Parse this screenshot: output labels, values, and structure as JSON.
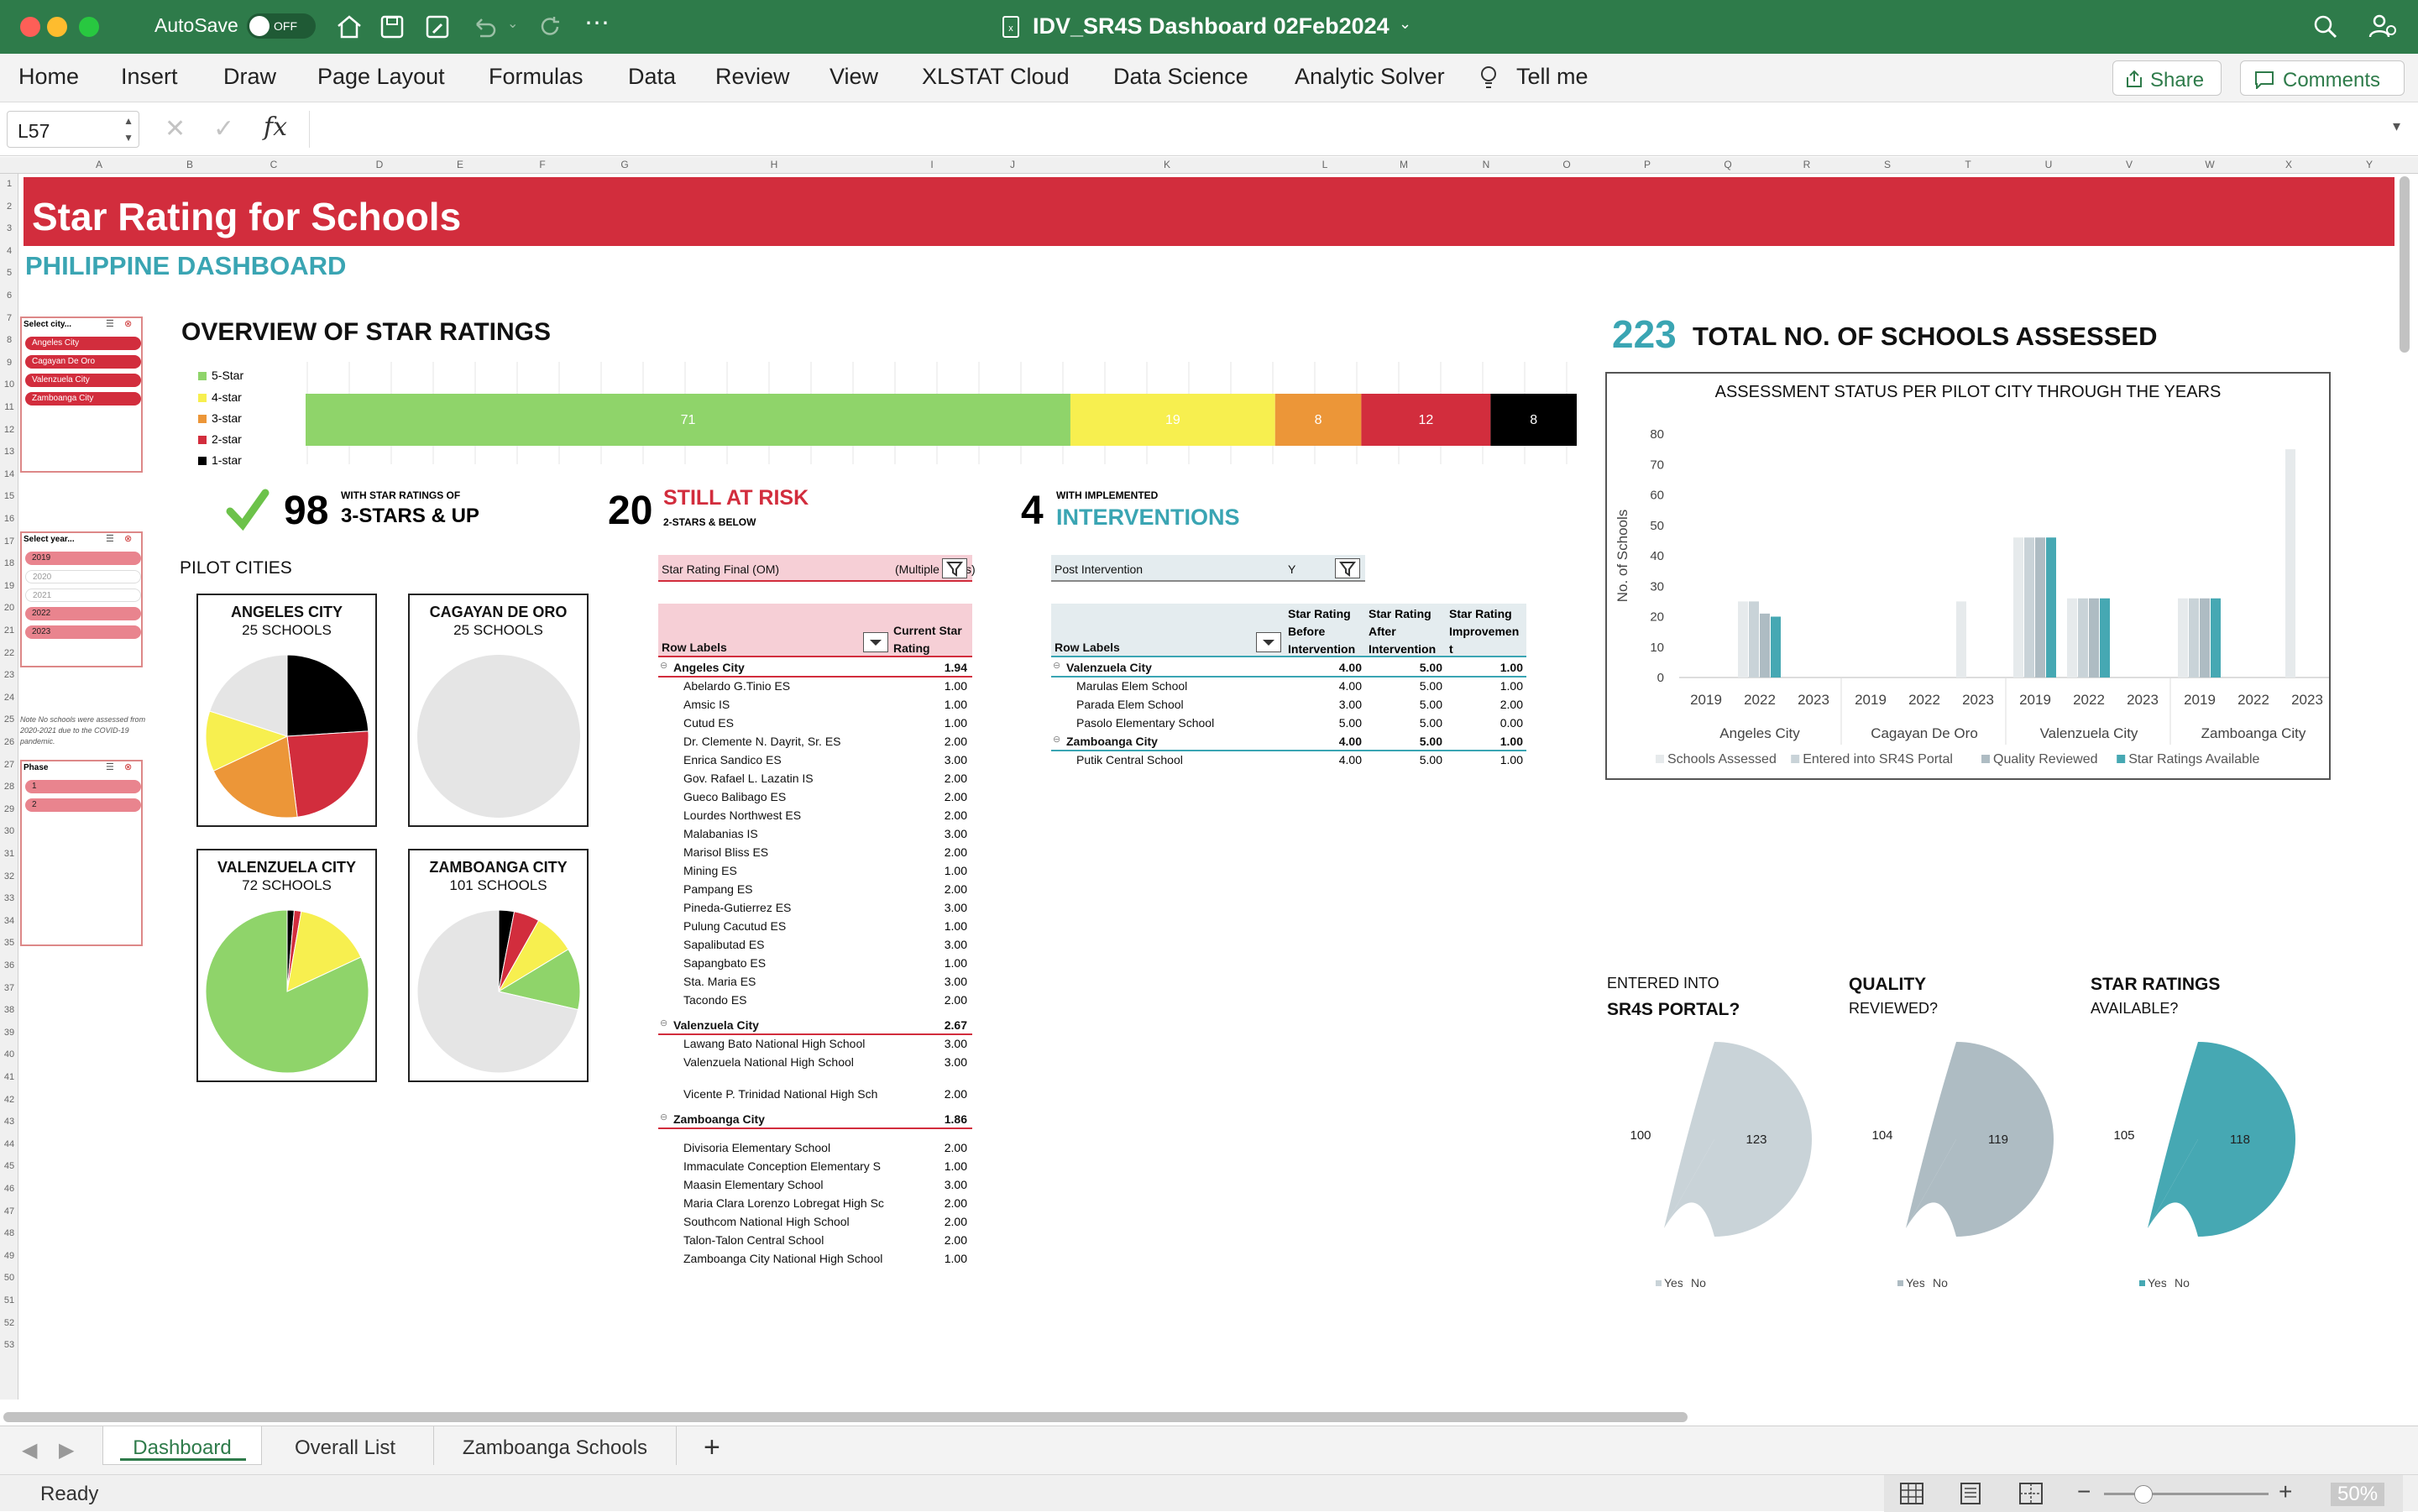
{
  "window": {
    "autosave": "AutoSave",
    "autosave_state": "OFF",
    "title": "IDV_SR4S Dashboard 02Feb2024"
  },
  "menu": {
    "items": [
      "Home",
      "Insert",
      "Draw",
      "Page Layout",
      "Formulas",
      "Data",
      "Review",
      "View",
      "XLSTAT Cloud",
      "Data Science",
      "Analytic Solver"
    ],
    "tell_me": "Tell me",
    "share": "Share",
    "comments": "Comments"
  },
  "formula": {
    "cell_ref": "L57",
    "fx": "fx",
    "value": ""
  },
  "columns": [
    "A",
    "B",
    "C",
    "D",
    "E",
    "F",
    "G",
    "H",
    "I",
    "J",
    "K",
    "L",
    "M",
    "N",
    "O",
    "P",
    "Q",
    "R",
    "S",
    "T",
    "U",
    "V",
    "W",
    "X",
    "Y"
  ],
  "rows": [
    "1",
    "2",
    "3",
    "4",
    "5",
    "6",
    "7",
    "8",
    "9",
    "10",
    "11",
    "12",
    "13",
    "14",
    "15",
    "16",
    "17",
    "18",
    "19",
    "20",
    "21",
    "22",
    "23",
    "24",
    "25",
    "26",
    "27",
    "28",
    "29",
    "30",
    "31",
    "32",
    "33",
    "34",
    "35",
    "36",
    "37",
    "38",
    "39",
    "40",
    "41",
    "42",
    "43",
    "44",
    "45",
    "46",
    "47",
    "48",
    "49",
    "50",
    "51",
    "52",
    "53"
  ],
  "dashboard": {
    "title": "Star Rating for Schools",
    "subtitle": "PHILIPPINE DASHBOARD",
    "overview_title": "OVERVIEW OF STAR RATINGS",
    "legend": [
      "5-Star",
      "4-star",
      "3-star",
      "2-star",
      "1-star"
    ],
    "star_colors": [
      "#8fd46a",
      "#f7ef4f",
      "#ec9638",
      "#d22d3d",
      "#000000"
    ],
    "bar_values": [
      71,
      19,
      8,
      12,
      8
    ],
    "kpi1_value": "98",
    "kpi1_label_small": "WITH STAR RATINGS OF",
    "kpi1_label_big": "3-STARS & UP",
    "kpi2_value": "20",
    "kpi2_label_big": "STILL AT RISK",
    "kpi2_label_small": "2-STARS & BELOW",
    "kpi3_value": "4",
    "kpi3_label_small": "WITH IMPLEMENTED",
    "kpi3_label_big": "INTERVENTIONS",
    "pilot_cities_title": "PILOT CITIES",
    "cities": [
      {
        "name": "ANGELES CITY",
        "schools": "25 SCHOOLS"
      },
      {
        "name": "CAGAYAN DE ORO",
        "schools": "25 SCHOOLS"
      },
      {
        "name": "VALENZUELA CITY",
        "schools": "72 SCHOOLS"
      },
      {
        "name": "ZAMBOANGA CITY",
        "schools": "101 SCHOOLS"
      }
    ],
    "total_value": "223",
    "total_label": "TOTAL NO. OF SCHOOLS ASSESSED"
  },
  "slicers": {
    "city": {
      "title": "Select city...",
      "items": [
        "Angeles City",
        "Cagayan De Oro",
        "Valenzuela City",
        "Zamboanga City"
      ]
    },
    "year": {
      "title": "Select year...",
      "items": [
        "2019",
        "2020",
        "2021",
        "2022",
        "2023"
      ]
    },
    "phase": {
      "title": "Phase",
      "items": [
        "1",
        "2"
      ]
    },
    "note": "Note No schools were assessed from 2020-2021 due to the COVID-19 pandemic."
  },
  "pivot1": {
    "filter_label": "Star Rating Final (OM)",
    "filter_value": "(Multiple Items)",
    "col_row": "Row Labels",
    "col_val": "Current Star Rating",
    "rows": [
      {
        "label": "Angeles City",
        "value": "1.94",
        "group": true
      },
      {
        "label": "Abelardo G.Tinio ES",
        "value": "1.00"
      },
      {
        "label": "Amsic IS",
        "value": "1.00"
      },
      {
        "label": "Cutud ES",
        "value": "1.00"
      },
      {
        "label": "Dr. Clemente N. Dayrit, Sr. ES",
        "value": "2.00"
      },
      {
        "label": "Enrica Sandico ES",
        "value": "3.00"
      },
      {
        "label": "Gov. Rafael L. Lazatin IS",
        "value": "2.00"
      },
      {
        "label": "Gueco Balibago ES",
        "value": "2.00"
      },
      {
        "label": "Lourdes Northwest ES",
        "value": "2.00"
      },
      {
        "label": "Malabanias IS",
        "value": "3.00"
      },
      {
        "label": "Marisol Bliss ES",
        "value": "2.00"
      },
      {
        "label": "Mining ES",
        "value": "1.00"
      },
      {
        "label": "Pampang ES",
        "value": "2.00"
      },
      {
        "label": "Pineda-Gutierrez ES",
        "value": "3.00"
      },
      {
        "label": "Pulung Cacutud ES",
        "value": "1.00"
      },
      {
        "label": "Sapalibutad ES",
        "value": "3.00"
      },
      {
        "label": "Sapangbato ES",
        "value": "1.00"
      },
      {
        "label": "Sta. Maria ES",
        "value": "3.00"
      },
      {
        "label": "Tacondo ES",
        "value": "2.00"
      },
      {
        "label": "Valenzuela City",
        "value": "2.67",
        "group": true
      },
      {
        "label": "Lawang Bato National High School",
        "value": "3.00"
      },
      {
        "label": "Valenzuela National High School",
        "value": "3.00"
      },
      {
        "label": "Vicente P. Trinidad National High Sch",
        "value": "2.00"
      },
      {
        "label": "Zamboanga City",
        "value": "1.86",
        "group": true
      },
      {
        "label": "Divisoria Elementary School",
        "value": "2.00"
      },
      {
        "label": "Immaculate Conception Elementary S",
        "value": "1.00"
      },
      {
        "label": "Maasin Elementary School",
        "value": "3.00"
      },
      {
        "label": "Maria Clara Lorenzo Lobregat High Sc",
        "value": "2.00"
      },
      {
        "label": "Southcom National High School",
        "value": "2.00"
      },
      {
        "label": "Talon-Talon Central School",
        "value": "2.00"
      },
      {
        "label": "Zamboanga City National High School",
        "value": "1.00"
      }
    ]
  },
  "pivot2": {
    "filter_label": "Post Intervention",
    "filter_value": "Y",
    "col_row": "Row Labels",
    "col_before": [
      "Star Rating",
      "Before",
      "Intervention"
    ],
    "col_after": [
      "Star Rating",
      "After",
      "Intervention"
    ],
    "col_impr": [
      "Star Rating",
      "Improvemen",
      "t"
    ],
    "rows": [
      {
        "label": "Valenzuela City",
        "before": "4.00",
        "after": "5.00",
        "impr": "1.00",
        "group": true
      },
      {
        "label": "Marulas Elem School",
        "before": "4.00",
        "after": "5.00",
        "impr": "1.00"
      },
      {
        "label": "Parada Elem School",
        "before": "3.00",
        "after": "5.00",
        "impr": "2.00"
      },
      {
        "label": "Pasolo Elementary School",
        "before": "5.00",
        "after": "5.00",
        "impr": "0.00"
      },
      {
        "label": "Zamboanga City",
        "before": "4.00",
        "after": "5.00",
        "impr": "1.00",
        "group": true
      },
      {
        "label": "Putik Central School",
        "before": "4.00",
        "after": "5.00",
        "impr": "1.00"
      }
    ]
  },
  "donuts": [
    {
      "title_top": "ENTERED INTO",
      "title_bottom": "SR4S PORTAL?",
      "yes": 123,
      "no": 100,
      "color": "#c9d3d8"
    },
    {
      "title_top": "QUALITY",
      "title_bottom": "REVIEWED?",
      "yes": 119,
      "no": 104,
      "color": "#aebcc3"
    },
    {
      "title_top": "STAR RATINGS",
      "title_bottom": "AVAILABLE?",
      "yes": 118,
      "no": 105,
      "color": "#46a8b3"
    }
  ],
  "donut_legend": {
    "yes": "Yes",
    "no": "No"
  },
  "chart_data": [
    {
      "type": "bar",
      "title": "ASSESSMENT STATUS PER PILOT CITY THROUGH THE YEARS",
      "ylabel": "No. of Schools",
      "ylim": [
        0,
        80
      ],
      "yticks": [
        0,
        10,
        20,
        30,
        40,
        50,
        60,
        70,
        80
      ],
      "groups": [
        "Angeles City",
        "Cagayan De Oro",
        "Valenzuela City",
        "Zamboanga City"
      ],
      "years": [
        "2019",
        "2022",
        "2023"
      ],
      "series": [
        {
          "name": "Schools Assessed",
          "color": "#e6eaec",
          "values": [
            [
              0,
              25,
              0
            ],
            [
              0,
              0,
              25
            ],
            [
              46,
              26,
              0
            ],
            [
              26,
              0,
              75
            ]
          ]
        },
        {
          "name": "Entered into SR4S Portal",
          "color": "#c9d3d8",
          "values": [
            [
              0,
              25,
              0
            ],
            [
              0,
              0,
              0
            ],
            [
              46,
              26,
              0
            ],
            [
              26,
              0,
              0
            ]
          ]
        },
        {
          "name": "Quality Reviewed",
          "color": "#aebcc3",
          "values": [
            [
              0,
              21,
              0
            ],
            [
              0,
              0,
              0
            ],
            [
              46,
              26,
              0
            ],
            [
              26,
              0,
              0
            ]
          ]
        },
        {
          "name": "Star Ratings Available",
          "color": "#46a8b3",
          "values": [
            [
              0,
              20,
              0
            ],
            [
              0,
              0,
              0
            ],
            [
              46,
              26,
              0
            ],
            [
              26,
              0,
              0
            ]
          ]
        }
      ]
    },
    {
      "type": "bar",
      "title": "OVERVIEW OF STAR RATINGS",
      "categories": [
        "5-Star",
        "4-star",
        "3-star",
        "2-star",
        "1-star"
      ],
      "values": [
        71,
        19,
        8,
        12,
        8
      ]
    },
    {
      "type": "pie",
      "title": "ANGELES CITY",
      "categories": [
        "5-Star",
        "4-star",
        "3-star",
        "2-star",
        "1-star"
      ],
      "values": [
        0,
        3,
        5,
        6,
        6
      ]
    },
    {
      "type": "pie",
      "title": "VALENZUELA CITY",
      "categories": [
        "5-Star",
        "4-star",
        "3-star",
        "2-star",
        "1-star"
      ],
      "values": [
        59,
        11,
        0,
        1,
        1
      ]
    },
    {
      "type": "pie",
      "title": "ZAMBOANGA CITY",
      "categories": [
        "5-Star",
        "4-star",
        "3-star",
        "2-star",
        "1-star"
      ],
      "values": [
        12,
        8,
        3,
        5,
        3
      ]
    }
  ],
  "sheets": [
    "Dashboard",
    "Overall List",
    "Zamboanga Schools"
  ],
  "status": {
    "ready": "Ready",
    "zoom": "50%"
  }
}
